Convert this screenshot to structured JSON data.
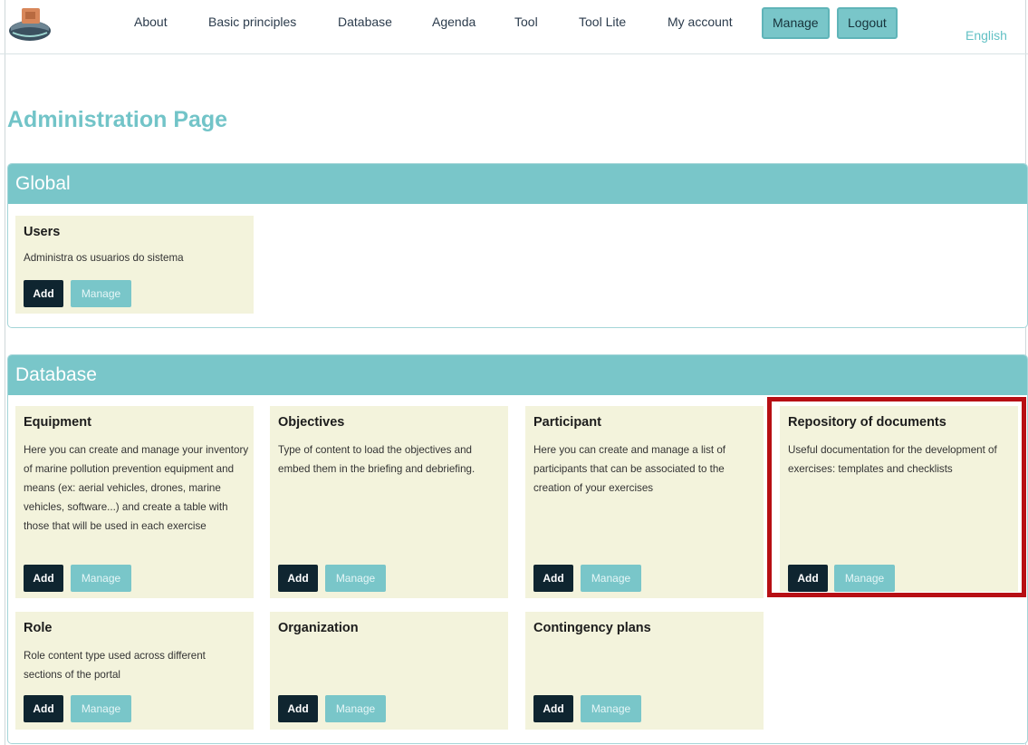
{
  "header": {
    "logo_icon": "marine-logo-icon",
    "nav": [
      {
        "label": "About"
      },
      {
        "label": "Basic principles"
      },
      {
        "label": "Database"
      },
      {
        "label": "Agenda"
      },
      {
        "label": "Tool"
      },
      {
        "label": "Tool Lite"
      },
      {
        "label": "My account"
      }
    ],
    "manage_label": "Manage",
    "logout_label": "Logout",
    "language": "English"
  },
  "page_title": "Administration Page",
  "global": {
    "title": "Global",
    "cards": [
      {
        "title": "Users",
        "description": "Administra os usuarios do sistema",
        "add": "Add",
        "manage": "Manage"
      }
    ]
  },
  "database": {
    "title": "Database",
    "cards": [
      {
        "title": "Equipment",
        "description": "Here you can create and manage your inventory of marine pollution prevention equipment and means (ex: aerial vehicles, drones, marine vehicles, software...) and create a table with those that will be used in each exercise",
        "add": "Add",
        "manage": "Manage"
      },
      {
        "title": "Objectives",
        "description": "Type of content to load the objectives and embed them in the briefing and debriefing.",
        "add": "Add",
        "manage": "Manage"
      },
      {
        "title": "Participant",
        "description": "Here you can create and manage a list of participants that can be associated to the creation of your exercises",
        "add": "Add",
        "manage": "Manage"
      },
      {
        "title": "Repository of documents",
        "description": "Useful documentation for the development of exercises: templates and checklists",
        "add": "Add",
        "manage": "Manage"
      },
      {
        "title": "Role",
        "description": "Role content type used across different sections of the portal",
        "add": "Add",
        "manage": "Manage"
      },
      {
        "title": "Organization",
        "description": "",
        "add": "Add",
        "manage": "Manage"
      },
      {
        "title": "Contingency plans",
        "description": "",
        "add": "Add",
        "manage": "Manage"
      }
    ]
  },
  "colors": {
    "accent": "#79c6c9",
    "card_bg": "#f3f3dc",
    "dark_button": "#0f2530",
    "highlight": "#b70f14"
  }
}
